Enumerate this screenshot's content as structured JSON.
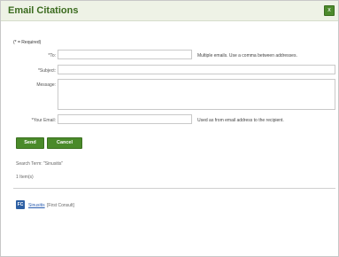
{
  "dialog": {
    "title": "Email Citations",
    "close_label": "x"
  },
  "form": {
    "required_note": "(* = Required)",
    "to_label": "*To:",
    "to_hint": "Multiple emails. Use a comma between addresses.",
    "subject_label": "*Subject:",
    "message_label": "Message:",
    "your_email_label": "*Your Email:",
    "your_email_hint": "Used as from email address to the recipient."
  },
  "actions": {
    "send_label": "Send",
    "cancel_label": "Cancel"
  },
  "meta": {
    "search_term": "Search Term: \"Sinusitis\"",
    "items_count": "1 Item(s)"
  },
  "results": [
    {
      "icon_text": "FC",
      "title": "Sinusitis",
      "source": "[First Consult]"
    }
  ]
}
